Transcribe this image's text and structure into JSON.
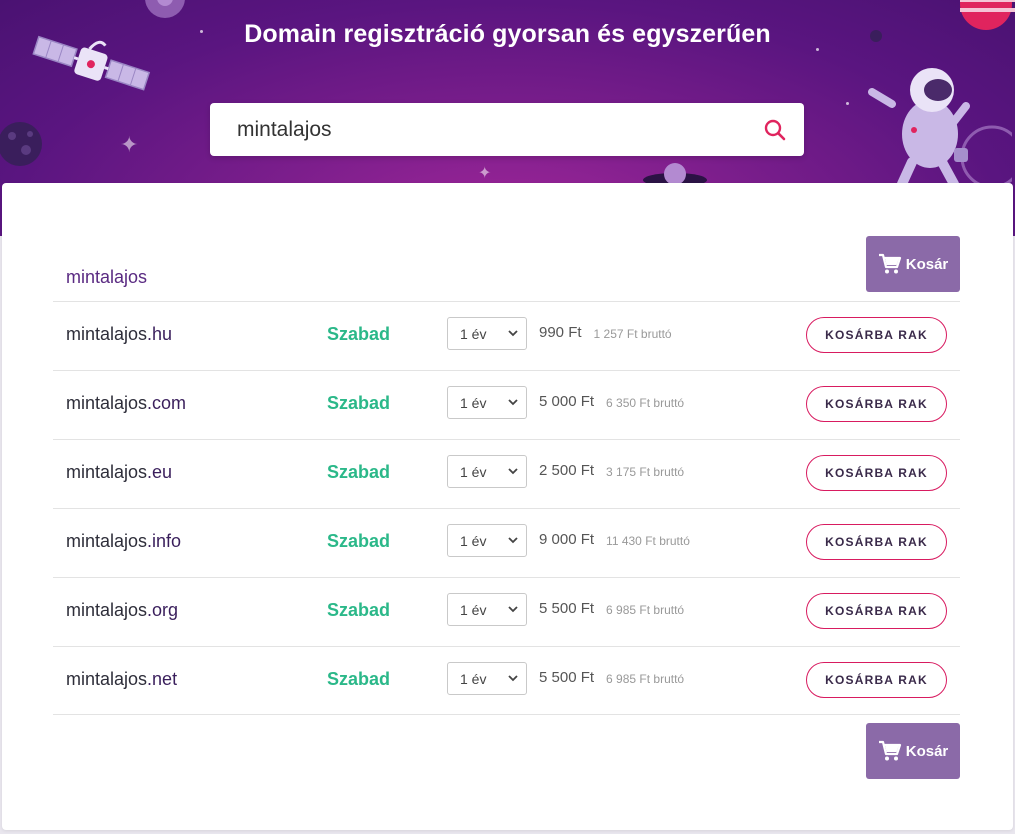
{
  "header": {
    "title": "Domain regisztráció gyorsan és egyszerűen"
  },
  "search": {
    "value": "mintalajos",
    "placeholder": ""
  },
  "results": {
    "query": "mintalajos",
    "cart_label": "Kosár",
    "add_label": "KOSÁRBA RAK",
    "rows": [
      {
        "name": "mintalajos",
        "tld": ".hu",
        "status": "Szabad",
        "period": "1 év",
        "price": "990 Ft",
        "gross": "1 257 Ft bruttó"
      },
      {
        "name": "mintalajos",
        "tld": ".com",
        "status": "Szabad",
        "period": "1 év",
        "price": "5 000 Ft",
        "gross": "6 350 Ft bruttó"
      },
      {
        "name": "mintalajos",
        "tld": ".eu",
        "status": "Szabad",
        "period": "1 év",
        "price": "2 500 Ft",
        "gross": "3 175 Ft bruttó"
      },
      {
        "name": "mintalajos",
        "tld": ".info",
        "status": "Szabad",
        "period": "1 év",
        "price": "9 000 Ft",
        "gross": "11 430 Ft bruttó"
      },
      {
        "name": "mintalajos",
        "tld": ".org",
        "status": "Szabad",
        "period": "1 év",
        "price": "5 500 Ft",
        "gross": "6 985 Ft bruttó"
      },
      {
        "name": "mintalajos",
        "tld": ".net",
        "status": "Szabad",
        "period": "1 év",
        "price": "5 500 Ft",
        "gross": "6 985 Ft bruttó"
      }
    ]
  },
  "colors": {
    "hero": "#6b1a88",
    "accent": "#8b6aa8",
    "available": "#2bb889",
    "button_border": "#d81b60"
  },
  "icons": {
    "search": "search-icon",
    "cart": "cart-icon",
    "select": "chevron-down-icon"
  }
}
